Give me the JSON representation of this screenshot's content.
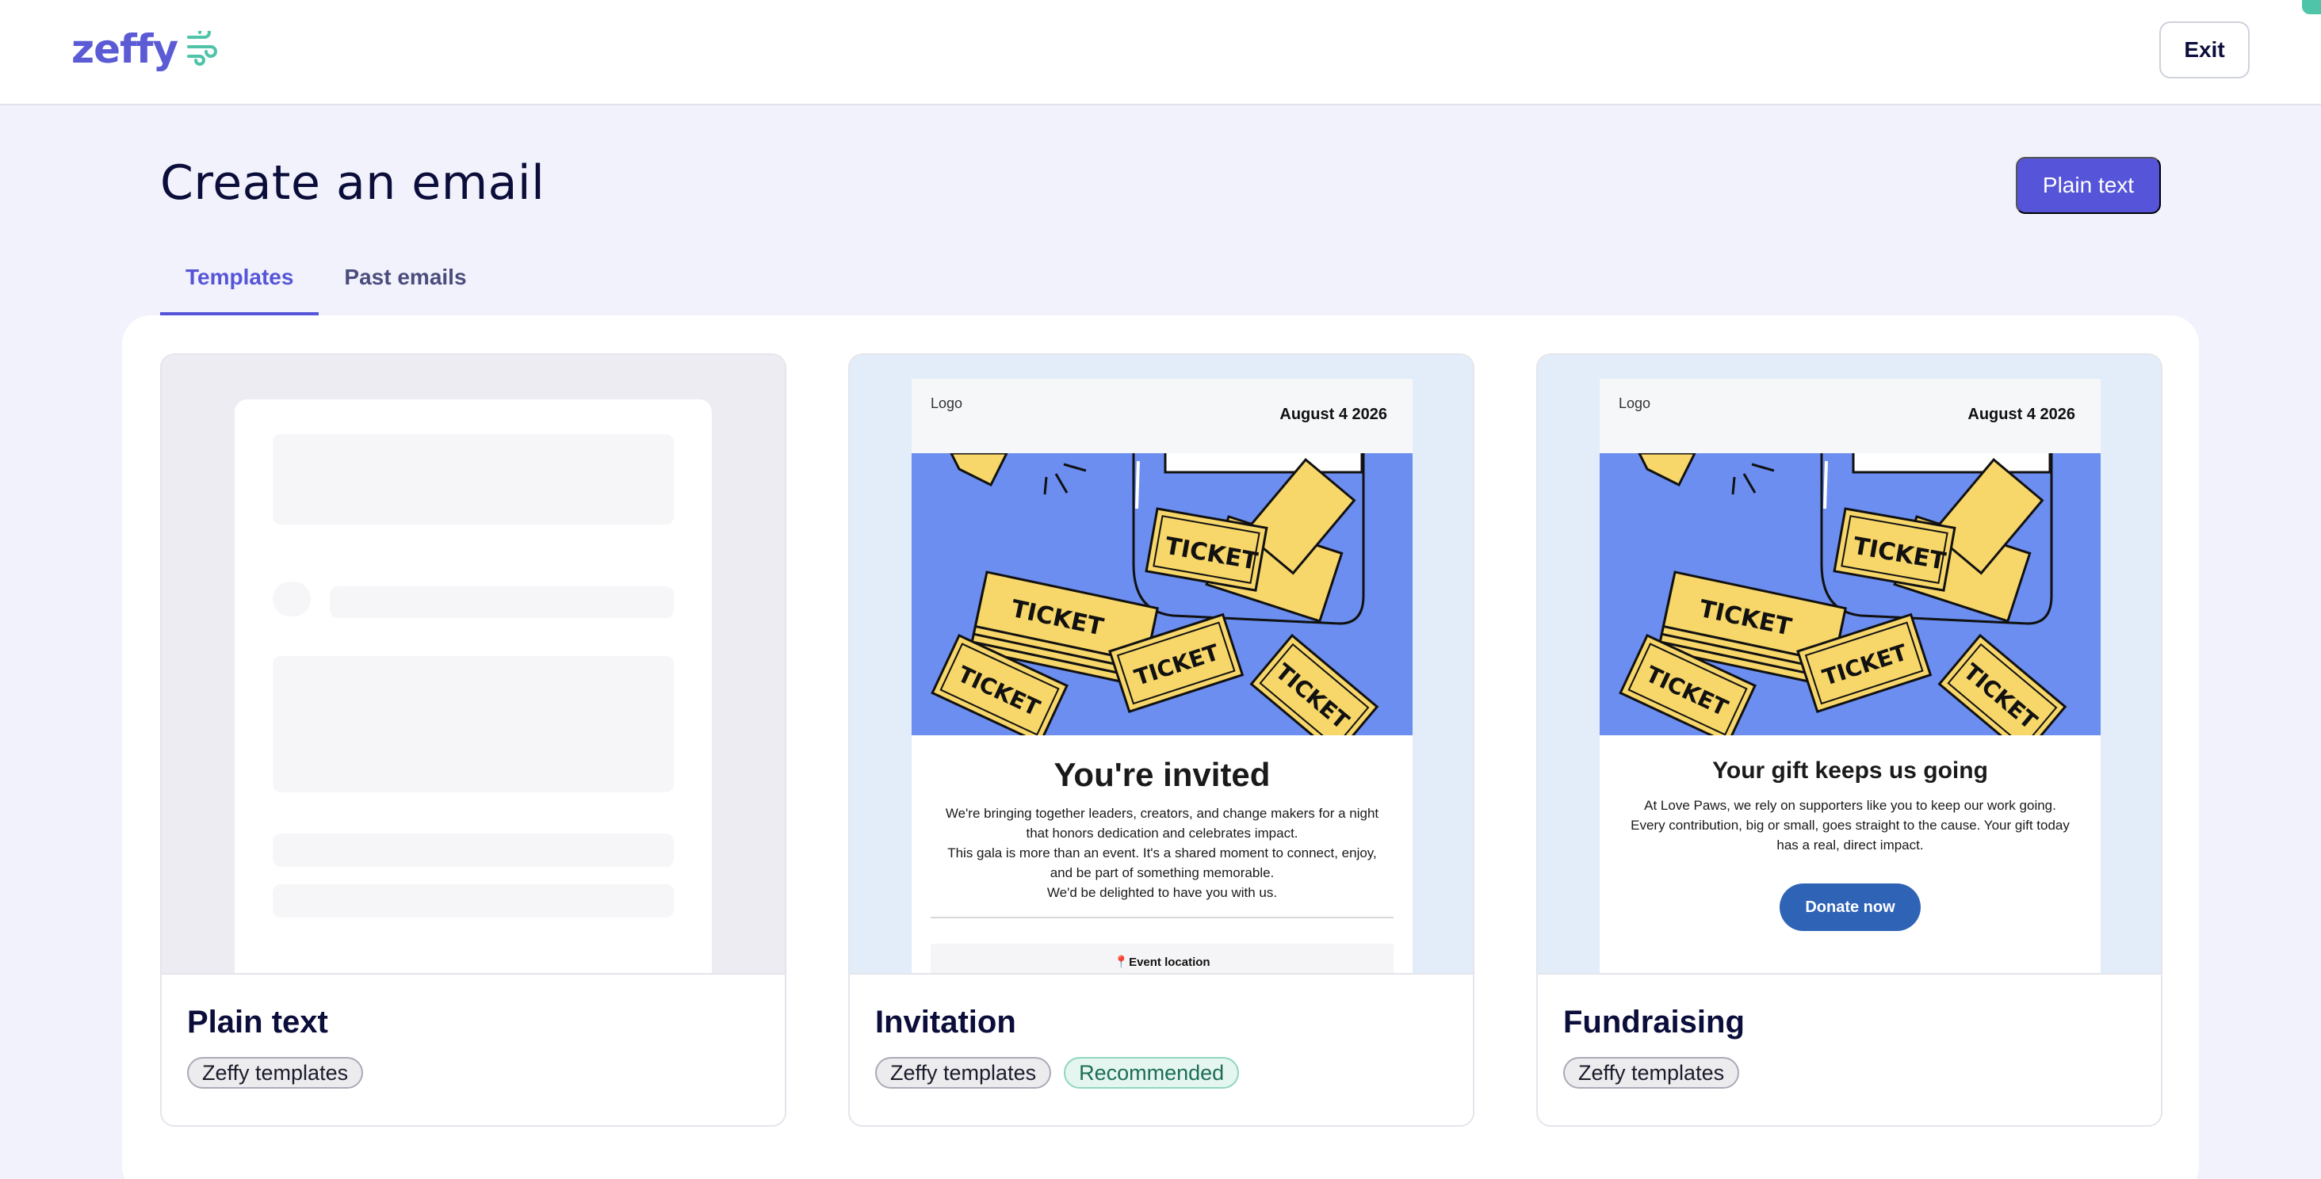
{
  "header": {
    "logo_text": "zeffy",
    "exit_label": "Exit"
  },
  "page": {
    "title": "Create an email",
    "plain_text_button": "Plain text"
  },
  "tabs": [
    {
      "label": "Templates",
      "active": true
    },
    {
      "label": "Past emails",
      "active": false
    }
  ],
  "cards": [
    {
      "title": "Plain text",
      "tags": [
        "Zeffy templates"
      ]
    },
    {
      "title": "Invitation",
      "tags": [
        "Zeffy templates",
        "Recommended"
      ],
      "preview": {
        "logo_alt": "Logo",
        "date": "August 4 2026",
        "heading": "You're invited",
        "paragraph_1": "We're bringing together leaders, creators, and change makers for a night that honors dedication and celebrates impact.",
        "paragraph_2": "This gala is more than an event. It's a shared moment to connect, enjoy, and be part of something memorable.",
        "paragraph_3": "We'd be delighted to have you with us.",
        "location_label": "Event location",
        "ticket_text": "TICKET"
      }
    },
    {
      "title": "Fundraising",
      "tags": [
        "Zeffy templates"
      ],
      "preview": {
        "logo_alt": "Logo",
        "date": "August 4 2026",
        "heading": "Your gift keeps us going",
        "paragraph": "At Love Paws, we rely on supporters like you to keep our work going. Every contribution, big or small, goes straight to the cause. Your gift today has a real, direct impact.",
        "button": "Donate now",
        "ticket_text": "TICKET"
      }
    }
  ],
  "colors": {
    "brand": "#5655d9",
    "accent_green": "#4fc4a8",
    "hero_blue": "#6b8ef0",
    "ticket_yellow": "#f7d66a",
    "donate_blue": "#2f63b6"
  }
}
